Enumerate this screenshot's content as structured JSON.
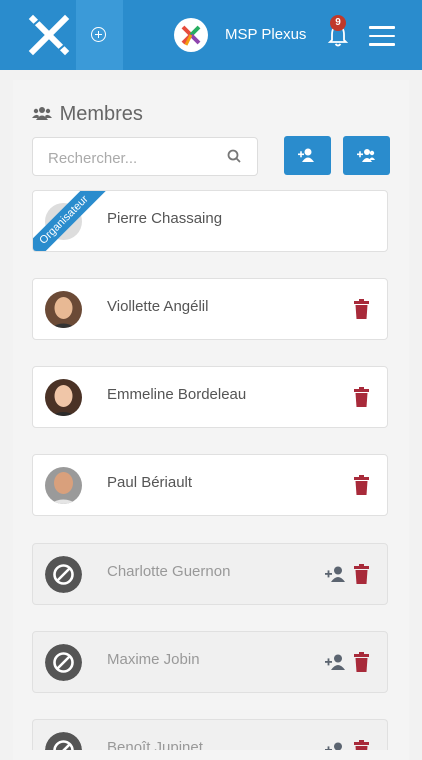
{
  "header": {
    "org_name": "MSP Plexus",
    "notification_count": "9",
    "brand_color": "#2a8ccd"
  },
  "section": {
    "title": "Membres"
  },
  "search": {
    "placeholder": "Rechercher..."
  },
  "organizer_ribbon": "Organisateur",
  "members": [
    {
      "name": "Pierre Chassaing",
      "status": "organizer"
    },
    {
      "name": "Viollette Angélil",
      "status": "active"
    },
    {
      "name": "Emmeline Bordeleau",
      "status": "active"
    },
    {
      "name": "Paul Bériault",
      "status": "active"
    },
    {
      "name": "Charlotte Guernon",
      "status": "pending"
    },
    {
      "name": "Maxime Jobin",
      "status": "pending"
    },
    {
      "name": "Benoît Jupinet",
      "status": "pending"
    }
  ],
  "colors": {
    "delete": "#a82a3a",
    "invite_icon": "#5b6470"
  }
}
